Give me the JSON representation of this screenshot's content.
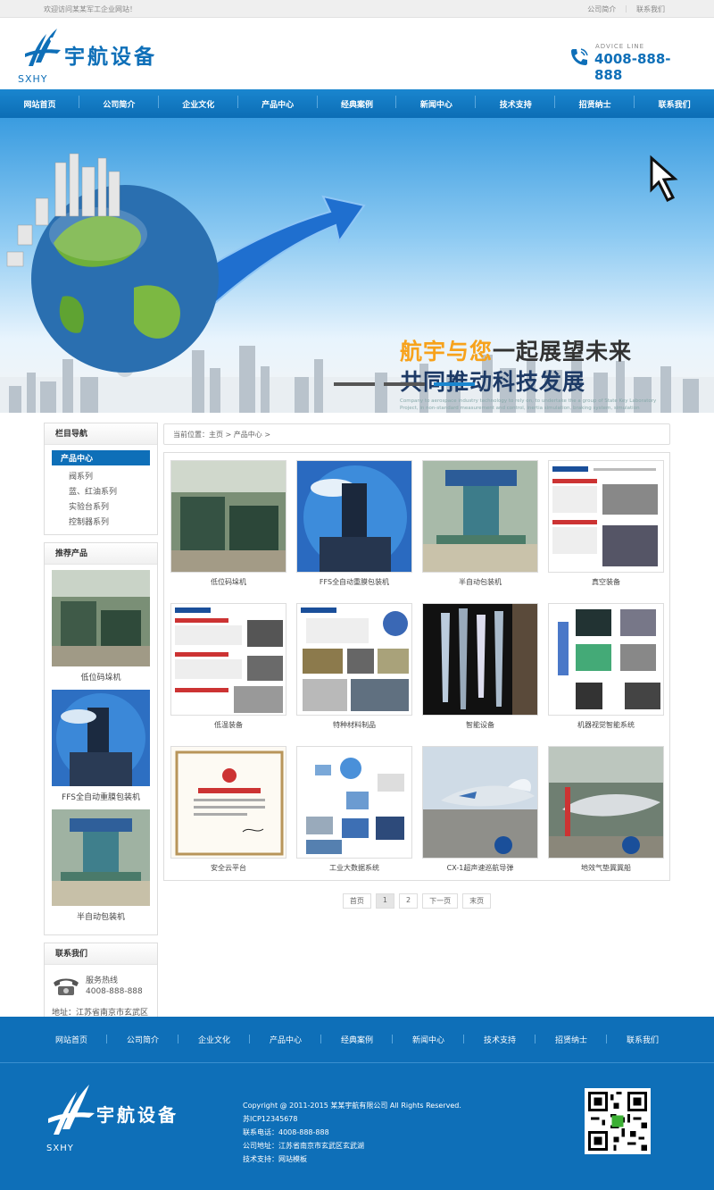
{
  "topbar": {
    "welcome": "欢迎访问某某军工企业网站！",
    "links": [
      "公司简介",
      "|",
      "联系我们"
    ]
  },
  "logo": {
    "cn": "宇航设备",
    "en": "SXHY"
  },
  "phone": {
    "label": "ADVICE LINE",
    "number": "4008-888-888"
  },
  "nav": [
    "网站首页",
    "公司简介",
    "企业文化",
    "产品中心",
    "经典案例",
    "新闻中心",
    "技术支持",
    "招贤纳士",
    "联系我们"
  ],
  "banner": {
    "h1_orange": "航宇与您",
    "h1_rest": "一起展望未来",
    "h2_a": "共同推动",
    "h2_b": "科技发展",
    "desc": "Company to aerospace industry technology to rely on, to undertake the a group of State Key Laboratory Project, in non-standard measurement and control, inertia simulation, braking system, simulation system, a synchronizer hanging when detection, high and low temperature, hydrostatic pressure testing Taiwan, bearing test machine."
  },
  "sidebar": {
    "nav_title": "栏目导航",
    "active": "产品中心",
    "subs": [
      "阀系列",
      "蓝、红油系列",
      "实验台系列",
      "控制器系列"
    ],
    "rec_title": "推荐产品",
    "rec": [
      "低位码垛机",
      "FFS全自动重膜包装机",
      "半自动包装机"
    ],
    "contact_title": "联系我们",
    "hotline_label": "服务热线",
    "hotline": "4008-888-888",
    "address": "地址：江苏省南京市玄武区玄武湖"
  },
  "crumb": "当前位置：主页 > 产品中心 >",
  "products": [
    "低位码垛机",
    "FFS全自动重膜包装机",
    "半自动包装机",
    "真空装备",
    "低温装备",
    "特种材料制品",
    "智能设备",
    "机器视觉智能系统",
    "安全云平台",
    "工业大数据系统",
    "CX-1超声速巡航导弹",
    "地效气垫冀冀船"
  ],
  "pager": [
    "首页",
    "1",
    "2",
    "下一页",
    "末页"
  ],
  "footer_nav": [
    "网站首页",
    "公司简介",
    "企业文化",
    "产品中心",
    "经典案例",
    "新闻中心",
    "技术支持",
    "招贤纳士",
    "联系我们"
  ],
  "footer": {
    "line1": "Copyright @ 2011-2015 某某宇航有限公司 All Rights Reserved.   苏ICP12345678",
    "line2": "联系电话：4008-888-888",
    "line3": "公司地址：江苏省南京市玄武区玄武湖",
    "line4": "技术支持：网站模板"
  },
  "colors": {
    "brand": "#0e6fb8",
    "accent": "#f7a21b"
  }
}
